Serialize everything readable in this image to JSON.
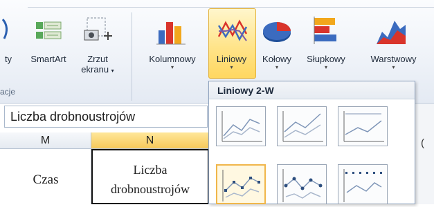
{
  "ribbon": {
    "partial_left_label": "ty",
    "smartart_label": "SmartArt",
    "screenshot_label_line1": "Zrzut",
    "screenshot_label_line2": "ekranu",
    "group_label": "acje",
    "charts": [
      {
        "label": "Kolumnowy",
        "icon": "column-chart-icon"
      },
      {
        "label": "Liniowy",
        "icon": "line-chart-icon",
        "selected": true
      },
      {
        "label": "Kołowy",
        "icon": "pie-chart-icon"
      },
      {
        "label": "Słupkowy",
        "icon": "bar-chart-icon"
      },
      {
        "label": "Warstwowy",
        "icon": "area-chart-icon"
      }
    ],
    "dropdown_arrow": "▾"
  },
  "namebox": {
    "value": "Liczba drobnoustrojów"
  },
  "grid": {
    "columns": [
      "M",
      "N"
    ],
    "partial_column": "(",
    "cell_m": "Czas",
    "cell_n_line1": "Liczba",
    "cell_n_line2": "drobnoustrojów"
  },
  "gallery": {
    "title": "Liniowy 2-W",
    "thumbnails": [
      "line",
      "stacked-line",
      "100-stacked-line",
      "line-with-markers",
      "stacked-line-with-markers",
      "100-stacked-line-with-markers"
    ]
  },
  "colors": {
    "selected_fill": "#ffe48a",
    "selected_border": "#e3b23c",
    "column_header_selected": "#f6c95a"
  }
}
